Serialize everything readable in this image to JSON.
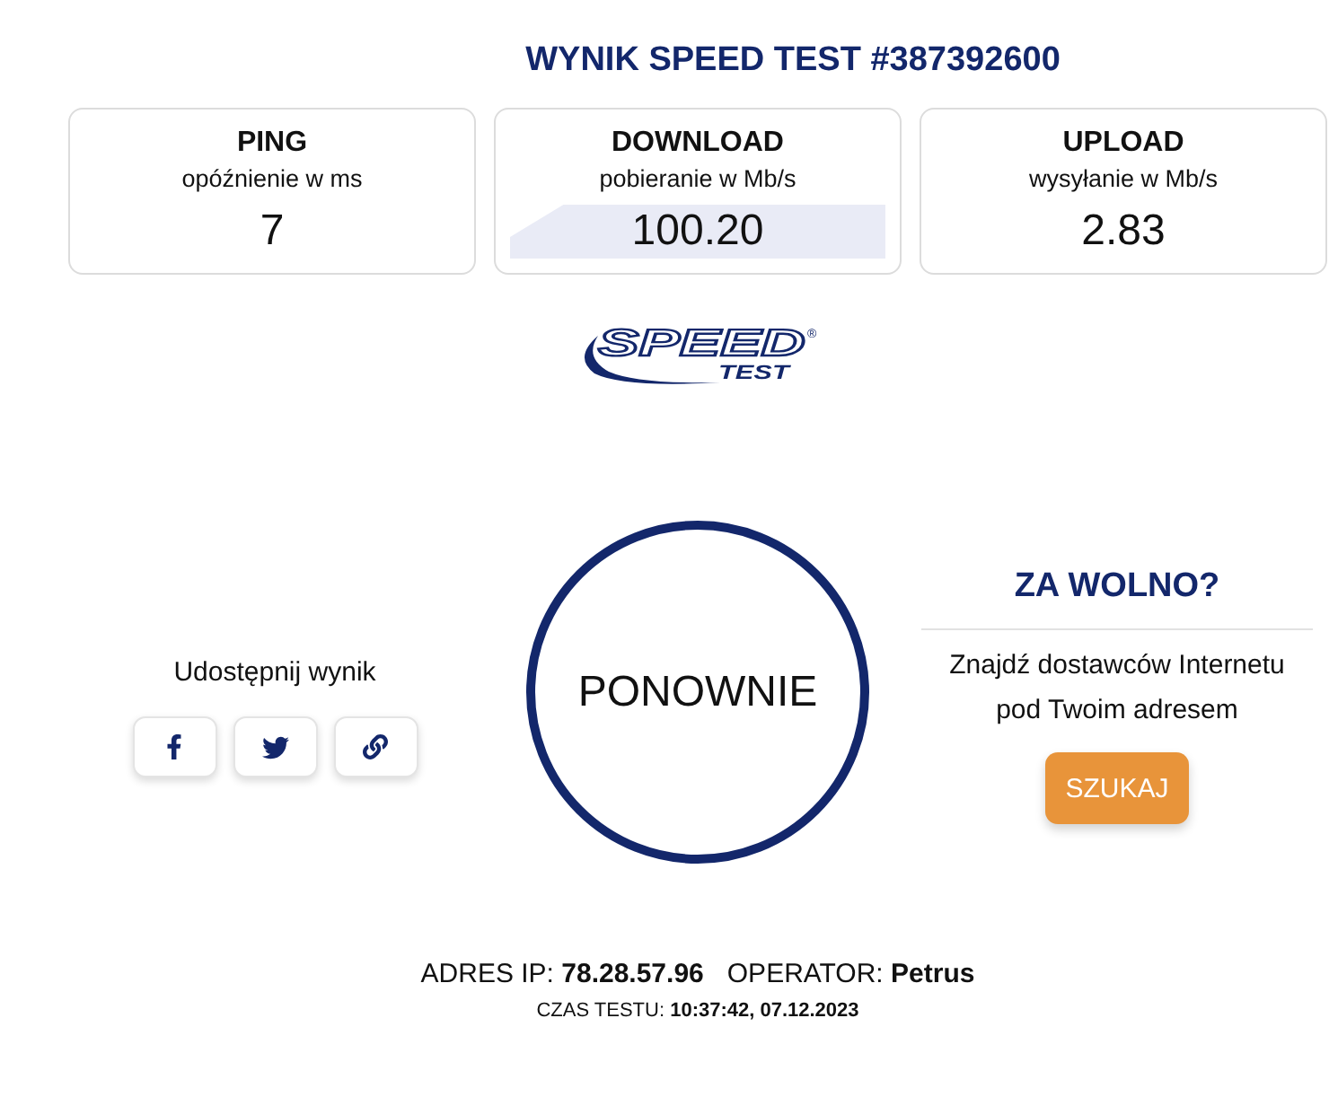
{
  "title": "WYNIK SPEED TEST #387392600",
  "results": [
    {
      "name": "PING",
      "unit": "opóźnienie w ms",
      "value": "7",
      "graph": false
    },
    {
      "name": "DOWNLOAD",
      "unit": "pobieranie w Mb/s",
      "value": "100.20",
      "graph": true
    },
    {
      "name": "UPLOAD",
      "unit": "wysyłanie w Mb/s",
      "value": "2.83",
      "graph": false
    }
  ],
  "logo": {
    "text": "SPEED",
    "subtext": "TEST",
    "mark": "®"
  },
  "share": {
    "label": "Udostępnij wynik",
    "buttons": [
      {
        "kind": "facebook"
      },
      {
        "kind": "twitter"
      },
      {
        "kind": "link"
      }
    ]
  },
  "retry": {
    "label": "PONOWNIE"
  },
  "promo": {
    "title": "ZA WOLNO?",
    "text": "Znajdź dostawców Internetu pod Twoim adresem",
    "button": "SZUKAJ"
  },
  "footer": {
    "ip": "ADRES IP: **78.28.57.96**",
    "operator": "OPERATOR: **Petrus**",
    "time": "CZAS TESTU: **10:37:42, 07.12.2023**"
  }
}
